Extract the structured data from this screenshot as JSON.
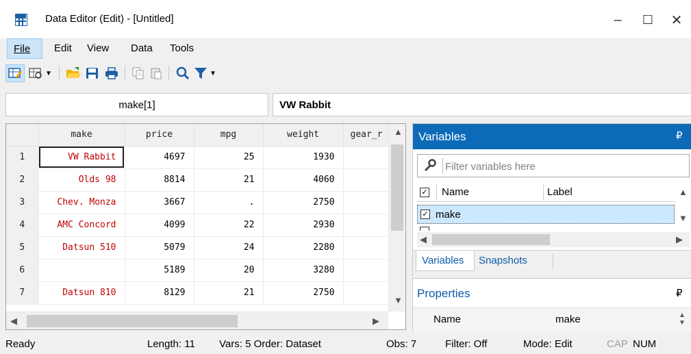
{
  "window": {
    "title": "Data Editor (Edit) - [Untitled]",
    "minimize": "–",
    "maximize": "☐",
    "close": "✕"
  },
  "menu": [
    {
      "label": "File"
    },
    {
      "label": "Edit"
    },
    {
      "label": "View"
    },
    {
      "label": "Data"
    },
    {
      "label": "Tools"
    }
  ],
  "toolbar_icons": [
    "edit-mode-icon",
    "browse-mode-icon",
    "open-icon",
    "save-icon",
    "print-icon",
    "copy-icon",
    "paste-icon",
    "find-icon",
    "filter-icon"
  ],
  "cell_ref": {
    "name": "make[1]",
    "value": "VW Rabbit"
  },
  "grid": {
    "columns": [
      "make",
      "price",
      "mpg",
      "weight",
      "gear_r"
    ],
    "rows": [
      {
        "n": "1",
        "make": "VW Rabbit",
        "price": "4697",
        "mpg": "25",
        "weight": "1930"
      },
      {
        "n": "2",
        "make": "Olds 98",
        "price": "8814",
        "mpg": "21",
        "weight": "4060"
      },
      {
        "n": "3",
        "make": "Chev. Monza",
        "price": "3667",
        "mpg": ".",
        "weight": "2750"
      },
      {
        "n": "4",
        "make": "AMC Concord",
        "price": "4099",
        "mpg": "22",
        "weight": "2930"
      },
      {
        "n": "5",
        "make": "Datsun 510",
        "price": "5079",
        "mpg": "24",
        "weight": "2280"
      },
      {
        "n": "6",
        "make": "",
        "price": "5189",
        "mpg": "20",
        "weight": "3280"
      },
      {
        "n": "7",
        "make": "Datsun 810",
        "price": "8129",
        "mpg": "21",
        "weight": "2750"
      }
    ]
  },
  "variables_panel": {
    "title": "Variables",
    "pin": "₽",
    "filter_placeholder": "Filter variables here",
    "col_name": "Name",
    "col_label": "Label",
    "rows": [
      {
        "name": "make",
        "checked": true
      }
    ],
    "tabs": [
      "Variables",
      "Snapshots"
    ]
  },
  "properties_panel": {
    "title": "Properties",
    "pin": "₽",
    "key": "Name",
    "value": "make"
  },
  "status": {
    "ready": "Ready",
    "length": "Length: 11",
    "vars": "Vars: 5 Order: Dataset",
    "obs": "Obs: 7",
    "filter": "Filter: Off",
    "mode": "Mode: Edit",
    "cap": "CAP",
    "num": "NUM"
  },
  "colors": {
    "accent": "#0d6ab8",
    "string_value": "#c00000",
    "selection": "#cce8ff"
  }
}
